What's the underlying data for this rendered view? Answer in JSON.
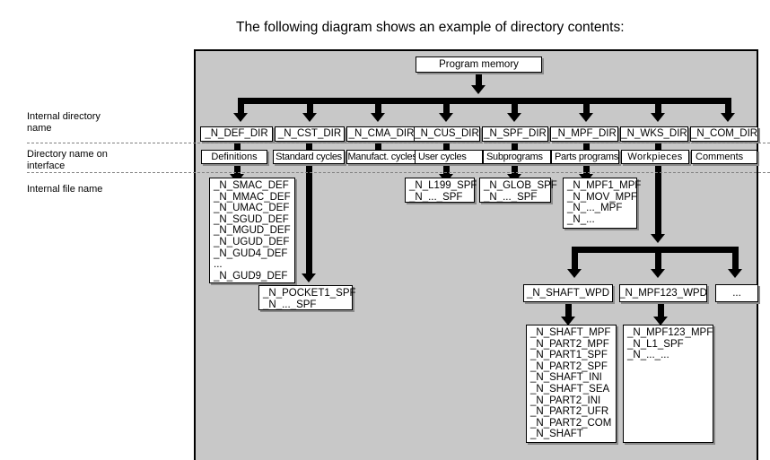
{
  "caption": "The following diagram shows an example of directory contents:",
  "annotations": [
    {
      "id": "internal-directory-name",
      "text": "Internal directory\nname"
    },
    {
      "id": "directory-name-on-interface",
      "text": "Directory name on\ninterface"
    },
    {
      "id": "internal-file-name",
      "text": "Internal file name"
    }
  ],
  "root": {
    "label": "Program memory"
  },
  "directories": [
    {
      "internal": "_N_DEF_DIR",
      "interface": "Definitions"
    },
    {
      "internal": "_N_CST_DIR",
      "interface": "Standard cycles"
    },
    {
      "internal": "_N_CMA_DIR",
      "interface": "Manufact. cycles"
    },
    {
      "internal": "_N_CUS_DIR",
      "interface": "User cycles"
    },
    {
      "internal": "_N_SPF_DIR",
      "interface": "Subprograms"
    },
    {
      "internal": "_N_MPF_DIR",
      "interface": "Parts programs"
    },
    {
      "internal": "_N_WKS_DIR",
      "interface": "Workpieces"
    },
    {
      "internal": "_N_COM_DIR",
      "interface": "Comments"
    }
  ],
  "file_lists": {
    "def": "_N_SMAC_DEF\n_N_MMAC_DEF\n_N_UMAC_DEF\n_N_SGUD_DEF\n_N_MGUD_DEF\n_N_UGUD_DEF\n_N_GUD4_DEF\n...\n_N_GUD9_DEF",
    "cst": "_N_POCKET1_SPF\n_N_..._SPF",
    "cus": "_N_L199_SPF\n_N_..._SPF",
    "spf": "_N_GLOB_SPF\n_N_..._SPF",
    "mpf": "_N_MPF1_MPF\n_N_MOV_MPF\n_N_..._MPF\n_N_...",
    "shaft_wpd_files": "_N_SHAFT_MPF\n_N_PART2_MPF\n_N_PART1_SPF\n_N_PART2_SPF\n_N_SHAFT_INI\n_N_SHAFT_SEA\n_N_PART2_INI\n_N_PART2_UFR\n_N_PART2_COM\n_N_SHAFT",
    "mpf123_wpd_files": "_N_MPF123_MPF\n_N_L1_SPF\n_N_..._..."
  },
  "workpieces": [
    {
      "label": "_N_SHAFT_WPD"
    },
    {
      "label": "_N_MPF123_WPD"
    },
    {
      "label": "..."
    }
  ],
  "colors": {
    "panel_background": "#c8c8c8",
    "box_fill": "#ffffff",
    "outline": "#000000",
    "rule": "#808080"
  }
}
